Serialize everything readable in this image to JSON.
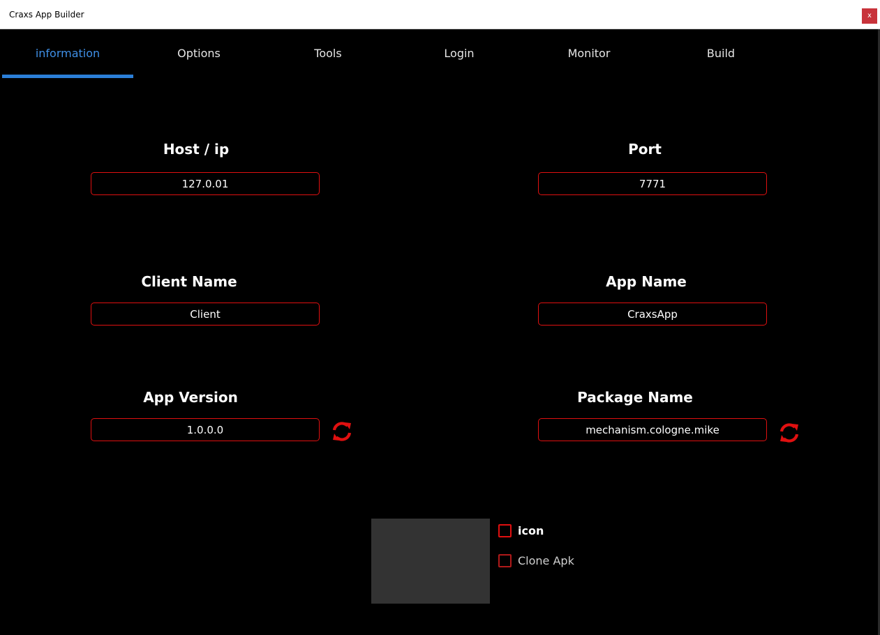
{
  "window": {
    "title": "Craxs App Builder",
    "close_label": "x"
  },
  "tabs": [
    {
      "label": "information",
      "active": true
    },
    {
      "label": "Options",
      "active": false
    },
    {
      "label": "Tools",
      "active": false
    },
    {
      "label": "Login",
      "active": false
    },
    {
      "label": "Monitor",
      "active": false
    },
    {
      "label": "Build",
      "active": false
    }
  ],
  "fields": {
    "host": {
      "label": "Host / ip",
      "value": "127.0.01"
    },
    "port": {
      "label": "Port",
      "value": "7771"
    },
    "client_name": {
      "label": "Client Name",
      "value": "Client"
    },
    "app_name": {
      "label": "App Name",
      "value": "CraxsApp"
    },
    "app_version": {
      "label": "App Version",
      "value": "1.0.0.0"
    },
    "package_name": {
      "label": "Package Name",
      "value": "mechanism.cologne.mike"
    }
  },
  "options": {
    "icon": {
      "label": "icon",
      "checked": false
    },
    "clone_apk": {
      "label": "Clone Apk",
      "checked": false
    }
  },
  "colors": {
    "accent_red": "#e01010",
    "active_tab": "#3f8fe6",
    "tab_indicator": "#2b7fd8",
    "background": "#000000"
  },
  "icons": {
    "refresh": "refresh-icon",
    "close": "close-icon"
  }
}
